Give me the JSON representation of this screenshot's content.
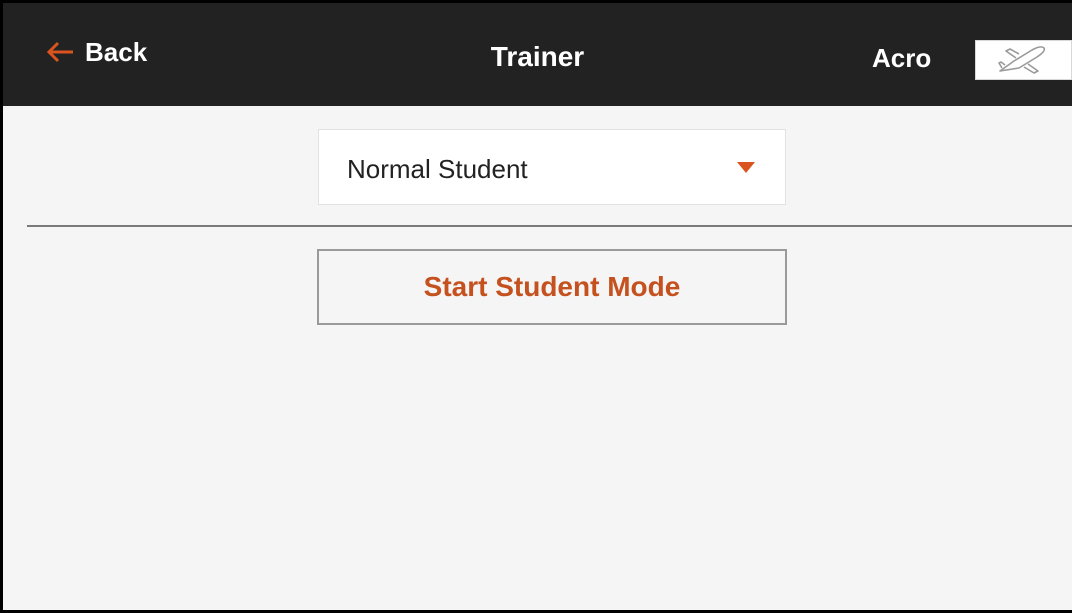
{
  "header": {
    "back_label": "Back",
    "title": "Trainer",
    "model_type": "Acro",
    "model_icon": "airplane-icon"
  },
  "trainer": {
    "mode_select": {
      "value": "Normal Student"
    },
    "start_button_label": "Start Student Mode"
  },
  "colors": {
    "accent": "#d9541e",
    "header_bg": "#222222",
    "screen_bg": "#f5f5f5"
  }
}
